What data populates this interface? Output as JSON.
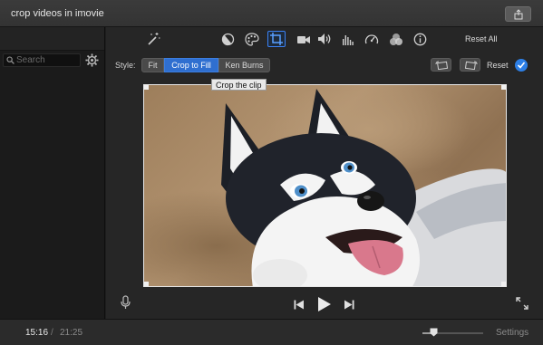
{
  "window": {
    "title": "crop videos in imovie"
  },
  "sidebar": {
    "search_placeholder": "Search"
  },
  "toolbar": {
    "tools": [
      "magic-wand",
      "color-balance",
      "color-correction",
      "crop",
      "stabilization",
      "volume",
      "noise-reduction",
      "speed",
      "video-filter",
      "info"
    ],
    "active_tool": "crop",
    "reset_all_label": "Reset All"
  },
  "crop": {
    "style_label": "Style:",
    "options": [
      "Fit",
      "Crop to Fill",
      "Ken Burns"
    ],
    "selected": "Crop to Fill",
    "tooltip": "Crop the clip",
    "reset_label": "Reset"
  },
  "playback": {
    "current_time": "15:16",
    "separator": "/",
    "total_time": "21:25"
  },
  "bottom": {
    "settings_label": "Settings",
    "zoom_level": 0.18
  },
  "colors": {
    "accent": "#2f6fd0",
    "apply": "#2d7fe6"
  }
}
